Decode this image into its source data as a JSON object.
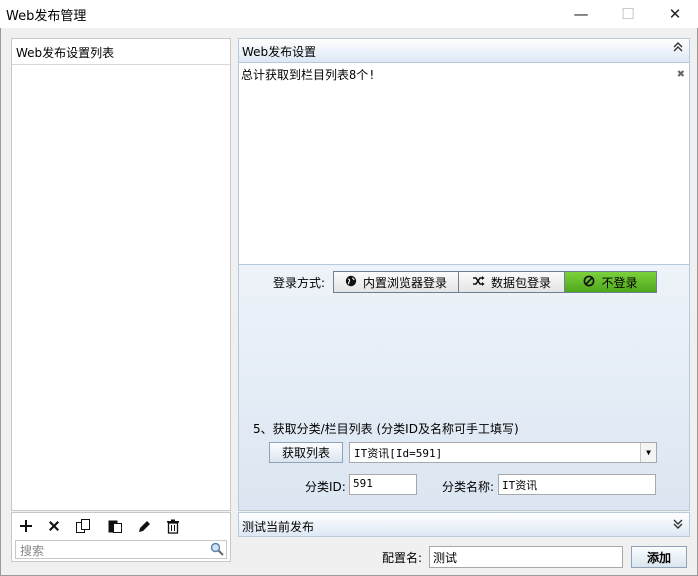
{
  "window": {
    "title": "Web发布管理",
    "controls": {
      "minimize": "—",
      "maximize": "☐",
      "close": "✕"
    }
  },
  "left_panel": {
    "header": "Web发布设置列表",
    "toolbar": [
      "plus-icon",
      "delete-icon",
      "copy-icon",
      "paste-icon",
      "edit-icon",
      "trash-icon"
    ],
    "search": {
      "placeholder": "搜索",
      "value": ""
    }
  },
  "right_panel": {
    "header": "Web发布设置",
    "collapse_glyph": "⌃",
    "log_text": "总计获取到栏目列表8个!",
    "clear_glyph": "✖",
    "login": {
      "label": "登录方式:",
      "options": [
        {
          "label": "内置浏览器登录",
          "icon": "globe-icon",
          "active": false
        },
        {
          "label": "数据包登录",
          "icon": "shuffle-icon",
          "active": false
        },
        {
          "label": "不登录",
          "icon": "ban-icon",
          "active": true
        }
      ]
    },
    "category_section": {
      "title": "5、获取分类/栏目列表 (分类ID及名称可手工填写)",
      "fetch_button": "获取列表",
      "selected": "IT资讯[Id=591]",
      "id_label": "分类ID:",
      "id_value": "591",
      "name_label": "分类名称:",
      "name_value": "IT资讯"
    }
  },
  "test_bar": {
    "label": "测试当前发布",
    "expand_glyph": "⌄"
  },
  "footer": {
    "config_label": "配置名:",
    "config_value": "测试",
    "add_button": "添加"
  },
  "colors": {
    "active_green": "#5cb82a",
    "panel_border": "#b8c9dc",
    "header_blue": "#dde8f5"
  }
}
